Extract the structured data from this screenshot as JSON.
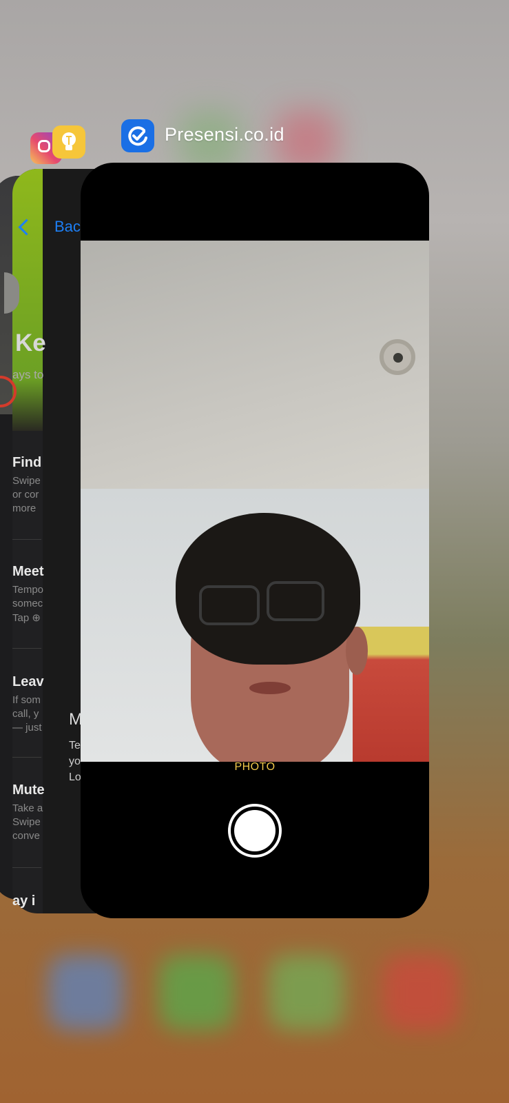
{
  "switcher": {
    "active_app_title": "Presensi.co.id",
    "icons": [
      "instagram-icon",
      "tips-icon",
      "presensi-icon"
    ]
  },
  "card_settings": {
    "back_label": "Back",
    "heading_fragment": "Ke",
    "sub_fragment": "ays to",
    "sections": [
      {
        "title": "Find",
        "lines": [
          "Swipe",
          "or cor",
          "more"
        ]
      },
      {
        "title": "Meet",
        "lines": [
          "Tempo",
          "somec",
          "Tap ⊕"
        ]
      },
      {
        "title": "Leav",
        "lines": [
          "If som",
          "call, y",
          "— just"
        ]
      },
      {
        "title": "Mute",
        "lines": [
          "Take a",
          "Swipe",
          "conve"
        ]
      },
      {
        "title": "ay i",
        "lines": []
      }
    ],
    "m_fragment": "M",
    "m_lines": [
      "Te",
      "yo",
      "Lo"
    ]
  },
  "camera": {
    "mode_label": "PHOTO",
    "accent": "#f2c94c"
  }
}
